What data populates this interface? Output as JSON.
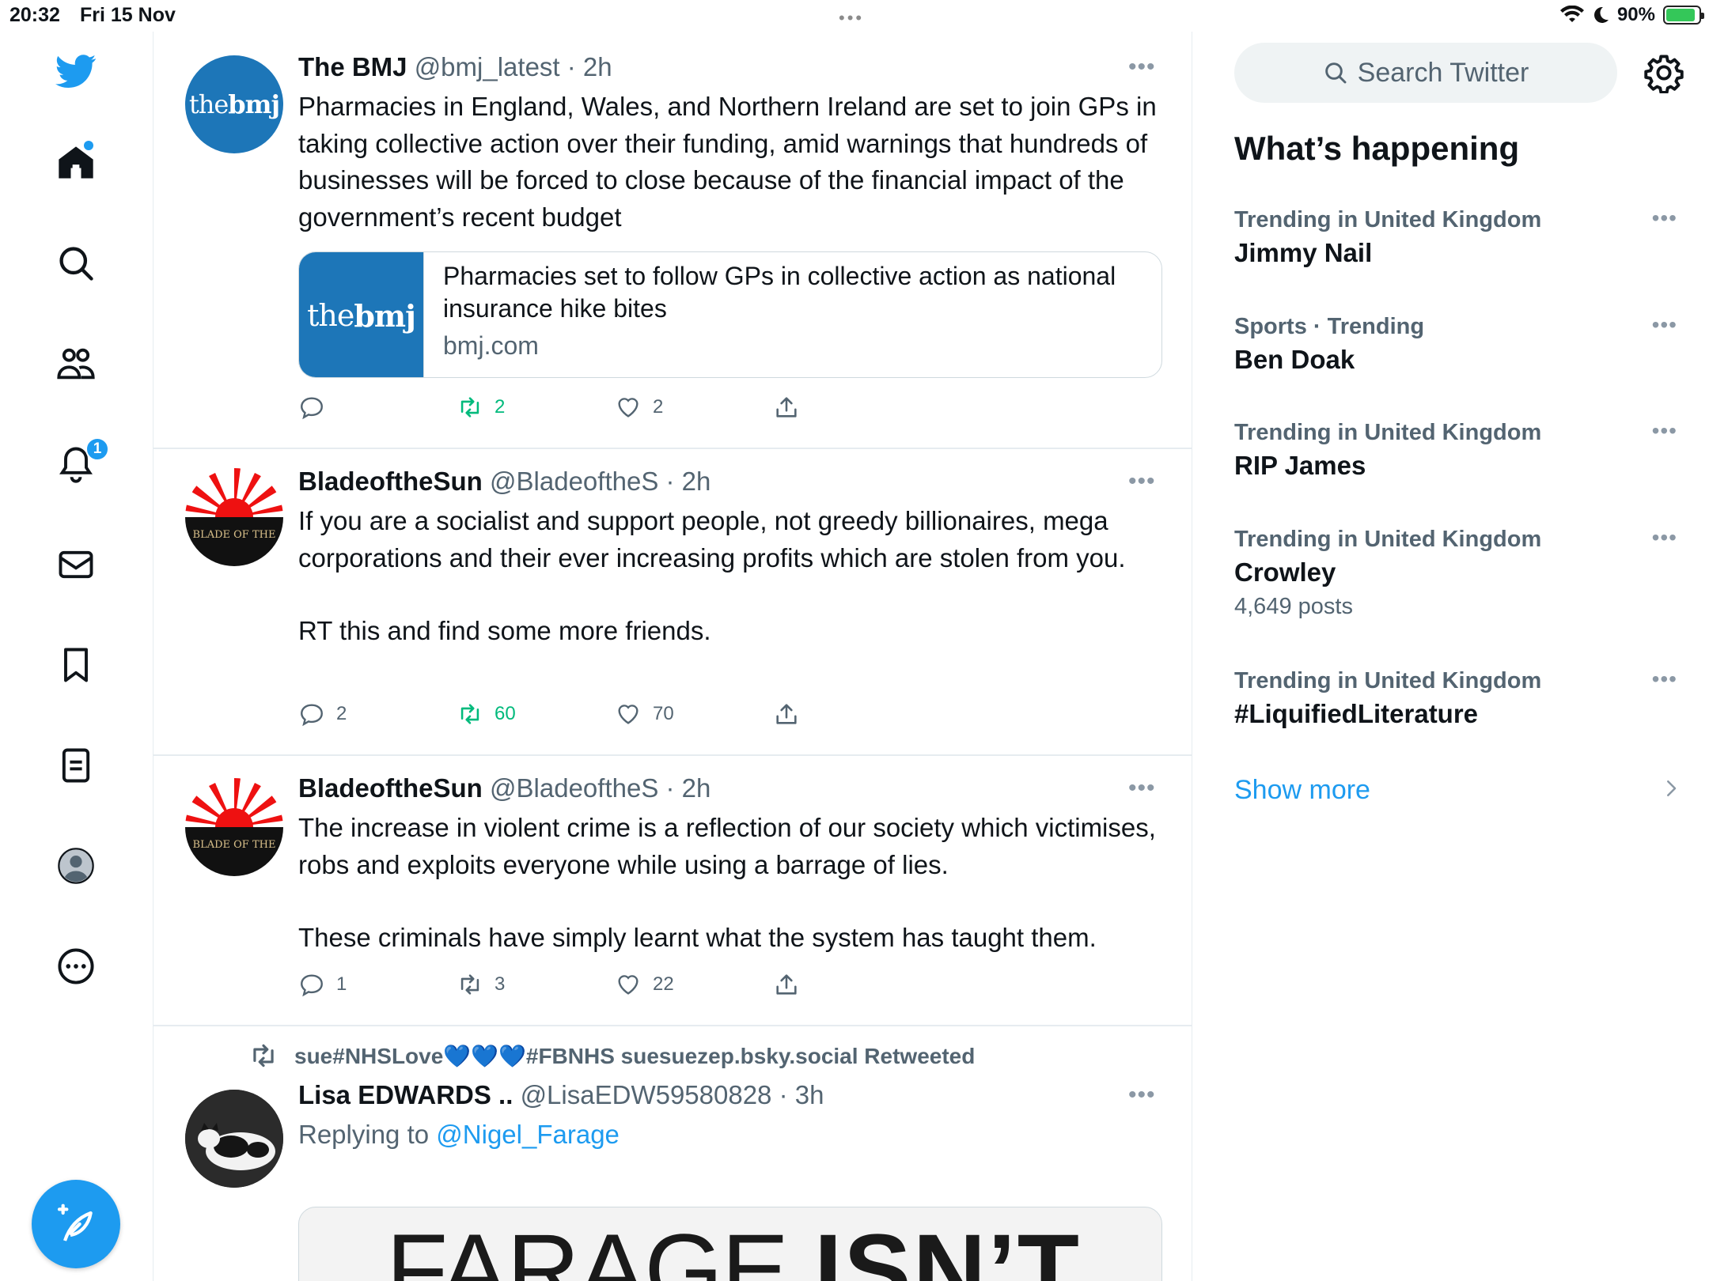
{
  "status_bar": {
    "time": "20:32",
    "date": "Fri 15 Nov",
    "battery": "90%",
    "battery_level": 0.9,
    "multitask_dots": "•••"
  },
  "nav": {
    "notifications_badge": "1",
    "icons": [
      "twitter-logo-icon",
      "home-icon",
      "search-icon",
      "communities-icon",
      "bell-icon",
      "mail-icon",
      "bookmark-icon",
      "lists-icon",
      "profile-icon",
      "more-circle-icon"
    ],
    "accent": "#1d9bf0"
  },
  "tweets": [
    {
      "name": "The BMJ",
      "handle": "@bmj_latest · 2h",
      "avatar_text_1": "the",
      "avatar_text_2": "bmj",
      "text": "Pharmacies in England, Wales, and Northern Ireland are set to join GPs in taking collective action over their funding, amid warnings that hundreds of businesses will be forced to close because of the financial impact of the government’s recent budget",
      "card": {
        "thumb_1": "the",
        "thumb_2": "bmj",
        "title": "Pharmacies set to follow GPs in collective action as national insurance hike bites",
        "domain": "bmj.com"
      },
      "replies": "",
      "retweets": "2",
      "likes": "2"
    },
    {
      "name": "BladeoftheSun",
      "handle": "@BladeoftheS · 2h",
      "avatar_text": "BLADE OF THE",
      "text_1": "If you are a socialist and support people, not greedy billionaires, mega corporations and their ever increasing profits which are stolen from you.",
      "text_2": "RT this and find some more friends.",
      "replies": "2",
      "retweets": "60",
      "likes": "70"
    },
    {
      "name": "BladeoftheSun",
      "handle": "@BladeoftheS · 2h",
      "avatar_text": "BLADE OF THE",
      "text_1": "The increase in violent crime is a reflection of our society which victimises, robs and exploits everyone while using a barrage of lies.",
      "text_2": "These criminals have simply learnt what the system has taught them.",
      "replies": "1",
      "retweets": "3",
      "likes": "22"
    },
    {
      "retweeted_by": "sue#NHSLove💙💙💙#FBNHS suesuezep.bsky.social Retweeted",
      "name": "Lisa EDWARDS ..",
      "handle": "@LisaEDW59580828 · 3h",
      "reply_prefix": "Replying to",
      "reply_to": "@Nigel_Farage",
      "media_text_1": "FARAGE",
      "media_text_2": "ISN’T"
    }
  ],
  "sidebar": {
    "search_placeholder": "Search Twitter",
    "title": "What’s happening",
    "trends": [
      {
        "context": "Trending in United Kingdom",
        "title": "Jimmy Nail",
        "count": ""
      },
      {
        "context": "Sports · Trending",
        "title": "Ben Doak",
        "count": ""
      },
      {
        "context": "Trending in United Kingdom",
        "title": "RIP James",
        "count": ""
      },
      {
        "context": "Trending in United Kingdom",
        "title": "Crowley",
        "count": "4,649 posts"
      },
      {
        "context": "Trending in United Kingdom",
        "title": "#LiquifiedLiterature",
        "count": ""
      }
    ],
    "show_more": "Show more",
    "more_dots": "•••"
  }
}
